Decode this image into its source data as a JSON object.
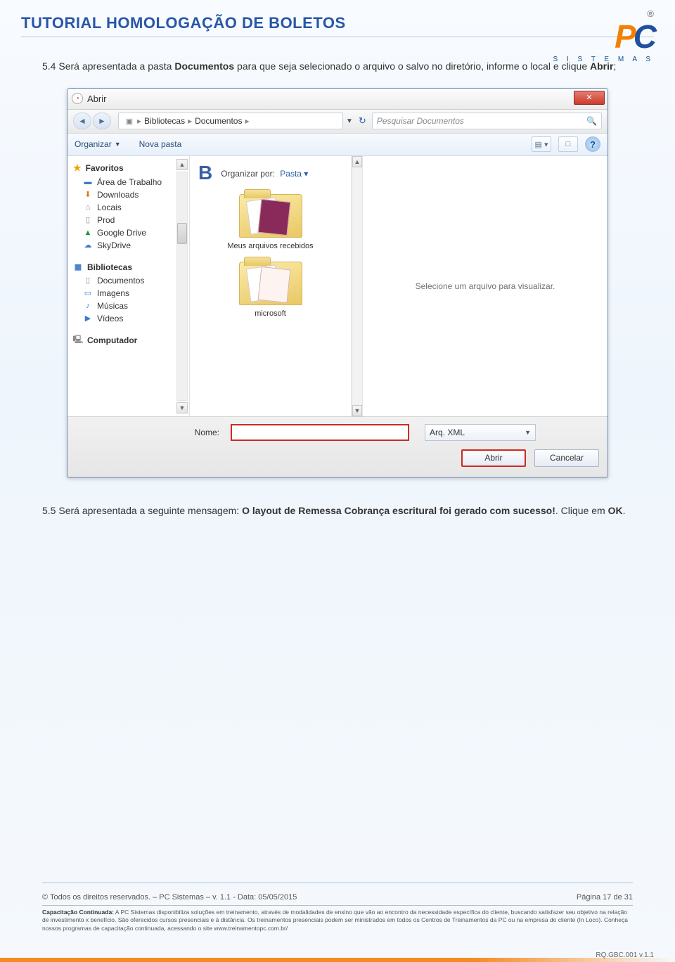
{
  "doc_title": "TUTORIAL HOMOLOGAÇÃO DE BOLETOS",
  "logo": {
    "p": "P",
    "c": "C",
    "sub": "S I S T E M A S",
    "reg": "®"
  },
  "step54": {
    "prefix": "5.4 Será apresentada a pasta ",
    "bold1": "Documentos",
    "mid": " para que seja selecionado o arquivo o salvo no diretório, informe o local e clique ",
    "bold2": "Abrir",
    "suffix": ";"
  },
  "dialog": {
    "title": "Abrir",
    "breadcrumb": {
      "a": "Bibliotecas",
      "b": "Documentos"
    },
    "search_placeholder": "Pesquisar Documentos",
    "toolbar": {
      "organizar": "Organizar",
      "nova_pasta": "Nova pasta"
    },
    "nav": {
      "favoritos": "Favoritos",
      "fav_items": [
        "Área de Trabalho",
        "Downloads",
        "Locais",
        "Prod",
        "Google Drive",
        "SkyDrive"
      ],
      "bibliotecas": "Bibliotecas",
      "bib_items": [
        "Documentos",
        "Imagens",
        "Músicas",
        "Vídeos"
      ],
      "computador": "Computador"
    },
    "file_area": {
      "letter": "B",
      "organizar_por": "Organizar por:",
      "pasta": "Pasta",
      "folder1": "Meus arquivos recebidos",
      "folder2": "microsoft",
      "preview_msg": "Selecione um arquivo para visualizar."
    },
    "bottom": {
      "nome": "Nome:",
      "type": "Arq. XML",
      "abrir": "Abrir",
      "cancelar": "Cancelar"
    }
  },
  "step55": {
    "prefix": "5.5 Será apresentada a seguinte mensagem: ",
    "bold1": "O layout de Remessa Cobrança escritural foi gerado com sucesso!",
    "mid": ". Clique em ",
    "bold2": "OK",
    "suffix": "."
  },
  "footer": {
    "copy_left": "© Todos os direitos reservados. – PC Sistemas – v. 1.1 - Data: 05/05/2015",
    "copy_right": "Página 17 de 31",
    "cap_bold": "Capacitação Continuada:",
    "cap_text": " A PC Sistemas disponibiliza soluções em treinamento, através de modalidades de ensino que vão ao encontro da necessidade específica do cliente, buscando satisfazer seu objetivo na relação de investimento x benefício. São oferecidos cursos presenciais e à distância. Os treinamentos presenciais podem ser ministrados em todos os Centros de Treinamentos da PC ou na empresa do cliente (In Loco). Conheça nossos programas de capacitação continuada, acessando o site www.treinamentopc.com.br/",
    "rq": "RQ.GBC.001 v.1.1"
  }
}
